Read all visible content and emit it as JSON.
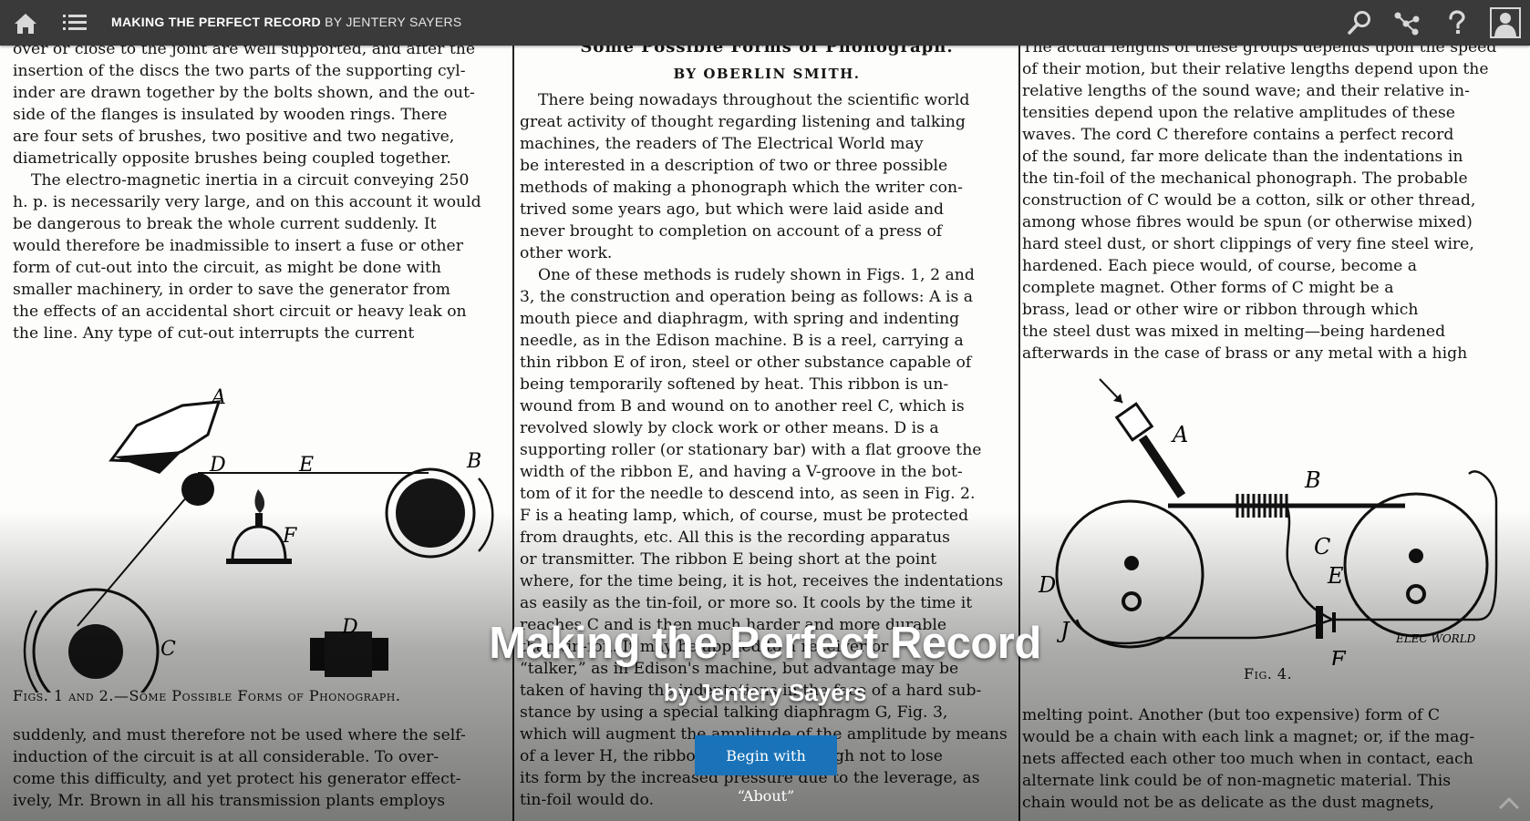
{
  "topbar": {
    "title": "MAKING THE PERFECT RECORD",
    "byline": "BY JENTERY SAYERS",
    "icons": [
      "home-icon",
      "menu-list-icon",
      "search-icon",
      "visualization-icon",
      "help-icon",
      "user-icon"
    ]
  },
  "hero": {
    "title": "Making the Perfect Record",
    "subtitle": "by Jentery Sayers",
    "button": "Begin with “About”"
  },
  "col1": {
    "lines_top": [
      "over or close to the joint are well supported, and after the",
      "insertion of the discs the two parts of the supporting cyl-",
      "inder are drawn together by the bolts shown, and the out-",
      "side of the flanges is insulated by wooden rings.  There",
      "are four sets of brushes, two positive and two negative,",
      "diametrically opposite brushes being coupled together.",
      "The electro-magnetic inertia in a circuit conveying 250",
      "h. p. is necessarily very large, and on this account it would",
      "be dangerous to break the whole current suddenly.  It",
      "would therefore be inadmissible to insert a fuse or other",
      "form of cut-out into the circuit, as might be done with",
      "smaller machinery, in order to save the generator from",
      "the effects of an accidental short circuit or heavy leak on",
      "the line.  Any type of cut-out interrupts the current"
    ],
    "fig_labels": [
      "A",
      "D",
      "E",
      "B",
      "F",
      "C",
      "D"
    ],
    "caption": "Figs. 1 and 2.—Some Possible Forms of Phonograph.",
    "lines_bottom": [
      "suddenly, and must therefore not be used where the self-",
      "induction of the circuit is at all considerable.  To over-",
      "come this difficulty, and yet protect his generator effect-",
      "ively, Mr. Brown in all his transmission plants employs"
    ]
  },
  "col2": {
    "heading": "Some Possible Forms of Phonograph.",
    "author": "BY OBERLIN SMITH.",
    "lines": [
      "There being nowadays throughout the scientific world",
      "great activity of thought regarding listening and talking",
      "machines, the readers of The Electrical World may",
      "be interested in a description of two or three possible",
      "methods of making a phonograph which the writer con-",
      "trived some years ago, but which were laid aside and",
      "never brought to completion on account of a press of",
      "other work.",
      "One of these methods is rudely shown in Figs. 1, 2 and",
      "3, the construction and operation being as follows: A is a",
      "mouth piece and diaphragm, with spring and indenting",
      "needle, as in the Edison machine.  B is a reel, carrying a",
      "thin ribbon E of iron, steel or other substance capable of",
      "being temporarily softened by heat.  This ribbon is un-",
      "wound from B and wound on to another reel C, which is",
      "revolved slowly by clock work or other means.  D is a",
      "supporting roller (or stationary bar) with a flat groove the",
      "width of the ribbon E, and having a V-groove in the bot-",
      "tom of it for the needle to descend into, as seen in Fig. 2.",
      "F is a heating lamp, which, of course, must be protected",
      "from draughts, etc.  All this is the recording apparatus",
      "or transmitter.  The ribbon E being short at the point",
      "where, for the time being, it is hot, receives the indentations",
      "as easily as the tin-foil, or more so.  It cools by the time it",
      "reaches C and is then much harder and more durable",
      "than tin-foil.  It may be applied to a receiver or",
      "“talker,” as in Edison's machine, but advantage may be",
      "taken of having the indentations in the face of a hard sub-",
      "stance by using a special talking diaphragm G, Fig. 3,",
      "which will augment the amplitude of the amplitude by means",
      "of a lever H, the ribbon being stiff enough not to lose",
      "its form by the increased pressure due to the leverage, as",
      "tin-foil would do."
    ]
  },
  "col3": {
    "lines_top": [
      "The actual lengths of these groups depends upon the speed",
      "of their motion, but their relative lengths depend upon the",
      "relative lengths of the sound wave; and their relative in-",
      "tensities depend upon the relative amplitudes of these",
      "waves.  The cord C therefore contains a perfect record",
      "of the sound, far more delicate than the indentations in",
      "the tin-foil of the mechanical phonograph.  The probable",
      "construction of C would be a cotton, silk or other thread,",
      "among whose fibres would be spun (or otherwise mixed)",
      "hard steel dust, or short clippings of very fine steel wire,",
      "hardened.  Each piece would, of course, become a",
      "complete magnet.  Other forms of C might be a",
      "brass, lead or other wire or ribbon through which",
      "the steel dust was mixed in melting—being hardened",
      "afterwards in the case of brass or any metal with a high"
    ],
    "fig_labels": [
      "A",
      "B",
      "C",
      "D",
      "E",
      "J",
      "F"
    ],
    "fig_stamp": "ELEC WORLD",
    "caption": "Fig. 4.",
    "lines_bottom": [
      "melting point.  Another (but too expensive) form of C",
      "would be a chain with each link a magnet; or, if the mag-",
      "nets affected each other too much when in contact, each",
      "alternate link could be of non-magnetic material.  This",
      "chain would not be as delicate as the dust magnets,"
    ]
  }
}
